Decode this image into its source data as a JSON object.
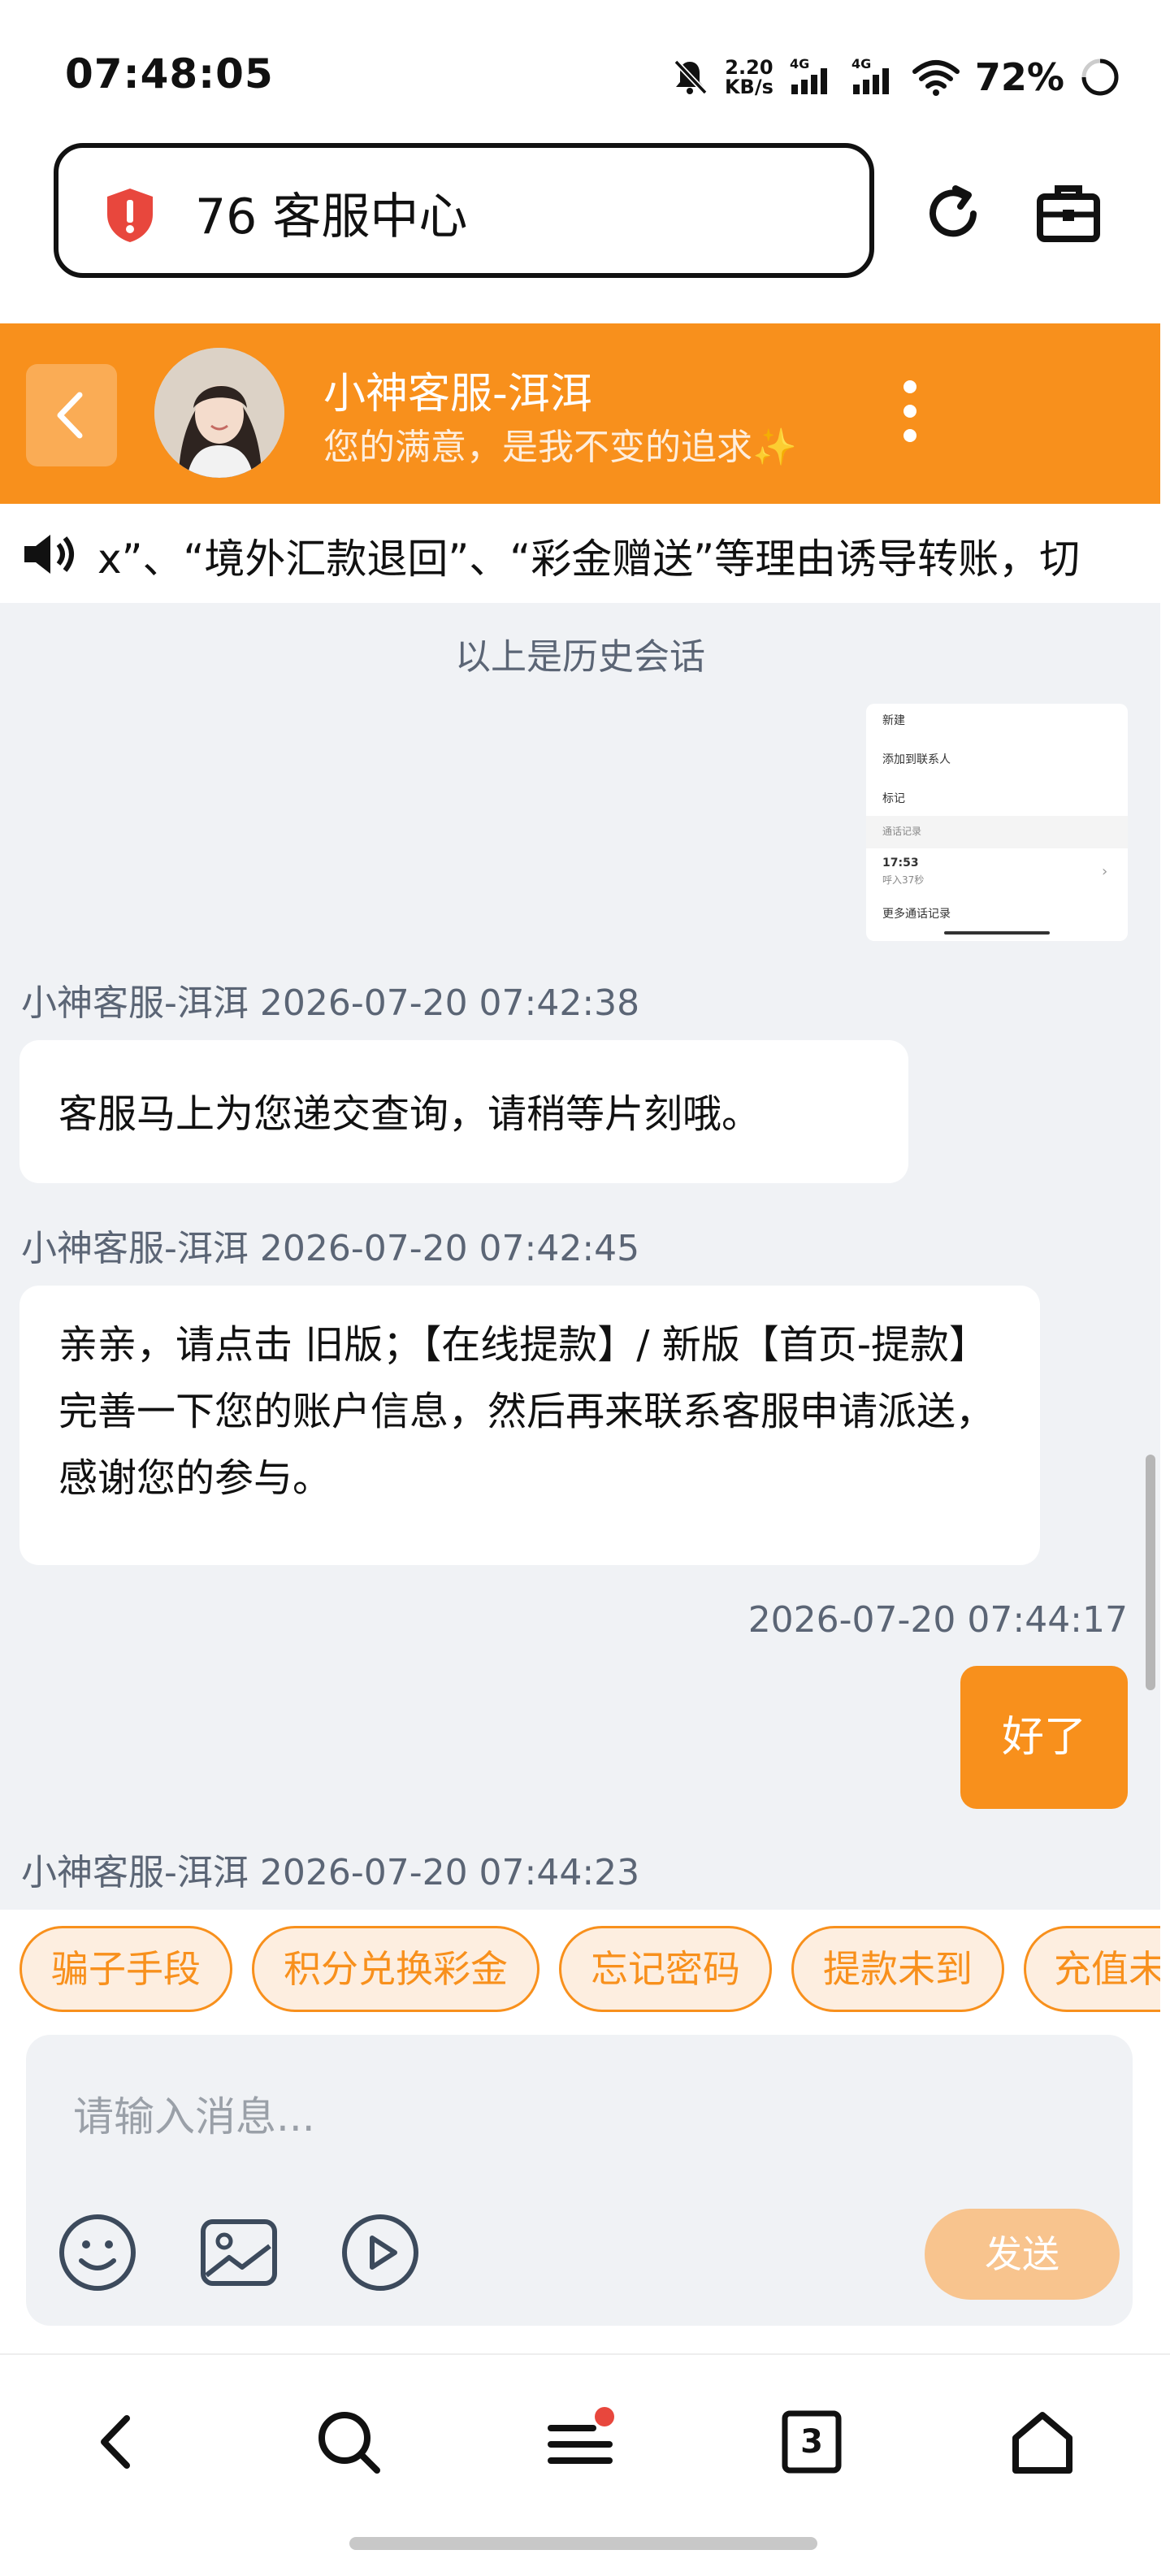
{
  "status_bar": {
    "time": "07:48:05",
    "net_speed_value": "2.20",
    "net_speed_unit": "KB/s",
    "signal1_label": "4G",
    "signal2_label": "4G",
    "battery": "72%"
  },
  "browser": {
    "url_title": "76 客服中心",
    "tab_count": "3"
  },
  "chat_header": {
    "agent_name": "小神客服-洱洱",
    "agent_tagline": "您的满意，是我不变的追求✨"
  },
  "notice": {
    "text": "x”、“境外汇款退回”、“彩金赠送”等理由诱导转账，切"
  },
  "chat": {
    "history_label": "以上是历史会话",
    "thumbnail": {
      "items": [
        "新建",
        "添加到联系人",
        "标记",
        "通话记录",
        "17:53",
        "呼入37秒",
        "更多通话记录"
      ]
    },
    "messages": [
      {
        "sender": "小神客服-洱洱 2026-07-20 07:42:38",
        "text": "客服马上为您递交查询，请稍等片刻哦。"
      },
      {
        "sender": "小神客服-洱洱 2026-07-20 07:42:45",
        "text": "亲亲，请点击 旧版；【在线提款】/ 新版【首页-提款】完善一下您的账户信息，然后再来联系客服申请派送，感谢您的参与。"
      },
      {
        "time": "2026-07-20 07:44:17",
        "text": "好了"
      },
      {
        "sender": "小神客服-洱洱 2026-07-20 07:44:23"
      }
    ]
  },
  "quick_replies": [
    "骗子手段",
    "积分兑换彩金",
    "忘记密码",
    "提款未到",
    "充值未"
  ],
  "input": {
    "placeholder": "请输入消息...",
    "send_label": "发送"
  },
  "colors": {
    "accent": "#f8901c",
    "chat_bg": "#f0f2f5",
    "send_disabled": "#f8c48e"
  }
}
